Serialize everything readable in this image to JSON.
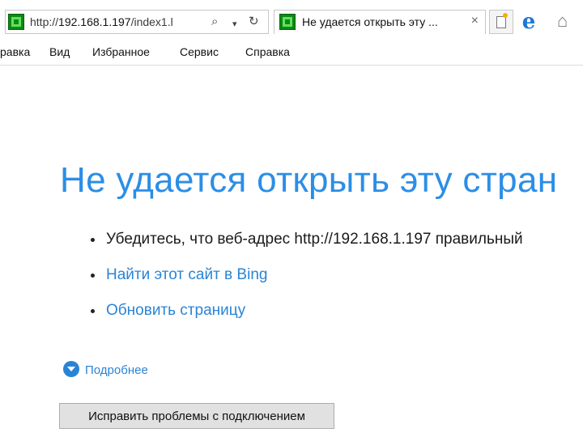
{
  "address_bar": {
    "url_prefix": "http://",
    "url_host": "192.168.1.197",
    "url_suffix": "/index1.l",
    "search_icon": "magnifier-icon",
    "dropdown_icon": "chevron-down-icon",
    "refresh_icon": "refresh-icon"
  },
  "tab": {
    "title": "Не удается открыть эту ...",
    "close_glyph": "×"
  },
  "toolbar_icons": [
    "new-tab-icon",
    "ie-logo-icon",
    "home-icon"
  ],
  "menu": {
    "items": [
      "равка",
      "Вид",
      "Избранное",
      "Сервис",
      "Справка"
    ]
  },
  "content": {
    "title": "Не удается открыть эту стран",
    "bullets": [
      {
        "text": "Убедитесь, что веб-адрес http://192.168.1.197 правильный",
        "link": false
      },
      {
        "text": "Найти этот сайт в Bing",
        "link": true
      },
      {
        "text": "Обновить страницу",
        "link": true
      }
    ],
    "details_label": "Подробнее",
    "fix_button_label": "Исправить проблемы с подключением"
  },
  "colors": {
    "title_blue": "#2b8ee6",
    "link_blue": "#2a84d6",
    "favicon_green": "#0c8a12"
  }
}
